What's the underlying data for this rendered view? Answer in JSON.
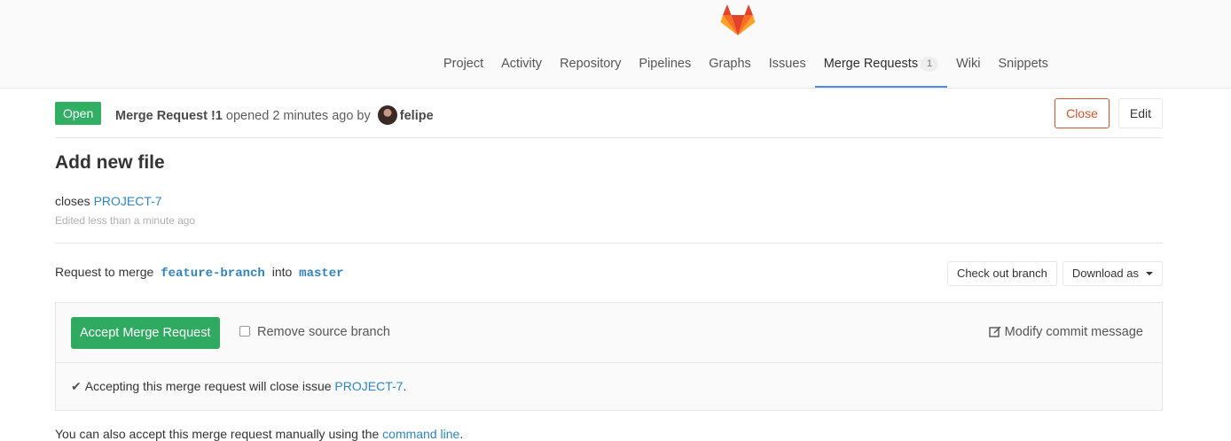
{
  "nav": {
    "items": [
      {
        "label": "Project"
      },
      {
        "label": "Activity"
      },
      {
        "label": "Repository"
      },
      {
        "label": "Pipelines"
      },
      {
        "label": "Graphs"
      },
      {
        "label": "Issues"
      },
      {
        "label": "Merge Requests",
        "count": "1",
        "active": true
      },
      {
        "label": "Wiki"
      },
      {
        "label": "Snippets"
      }
    ]
  },
  "header": {
    "status": "Open",
    "mr_label": "Merge Request !1",
    "opened_text": "opened 2 minutes ago by",
    "author": "felipe",
    "close_label": "Close",
    "edit_label": "Edit"
  },
  "mr": {
    "title": "Add new file",
    "description_prefix": "closes",
    "description_link": "PROJECT-7",
    "edited": "Edited less than a minute ago"
  },
  "merge": {
    "prefix": "Request to merge",
    "source_branch": "feature-branch",
    "into": "into",
    "target_branch": "master",
    "checkout_label": "Check out branch",
    "download_label": "Download as"
  },
  "widget": {
    "accept_label": "Accept Merge Request",
    "remove_source_label": "Remove source branch",
    "modify_commit_label": "Modify commit message",
    "closes_prefix": "Accepting this merge request will close issue",
    "closes_issue": "PROJECT-7",
    "closes_suffix": "."
  },
  "footer": {
    "prefix": "You can also accept this merge request manually using the",
    "link": "command line",
    "suffix": "."
  },
  "colors": {
    "open_green": "#31af64",
    "accept_green": "#2faa60",
    "close_red": "#d2542f",
    "link_blue": "#3084bb",
    "active_tab_underline": "#4a8bee"
  }
}
